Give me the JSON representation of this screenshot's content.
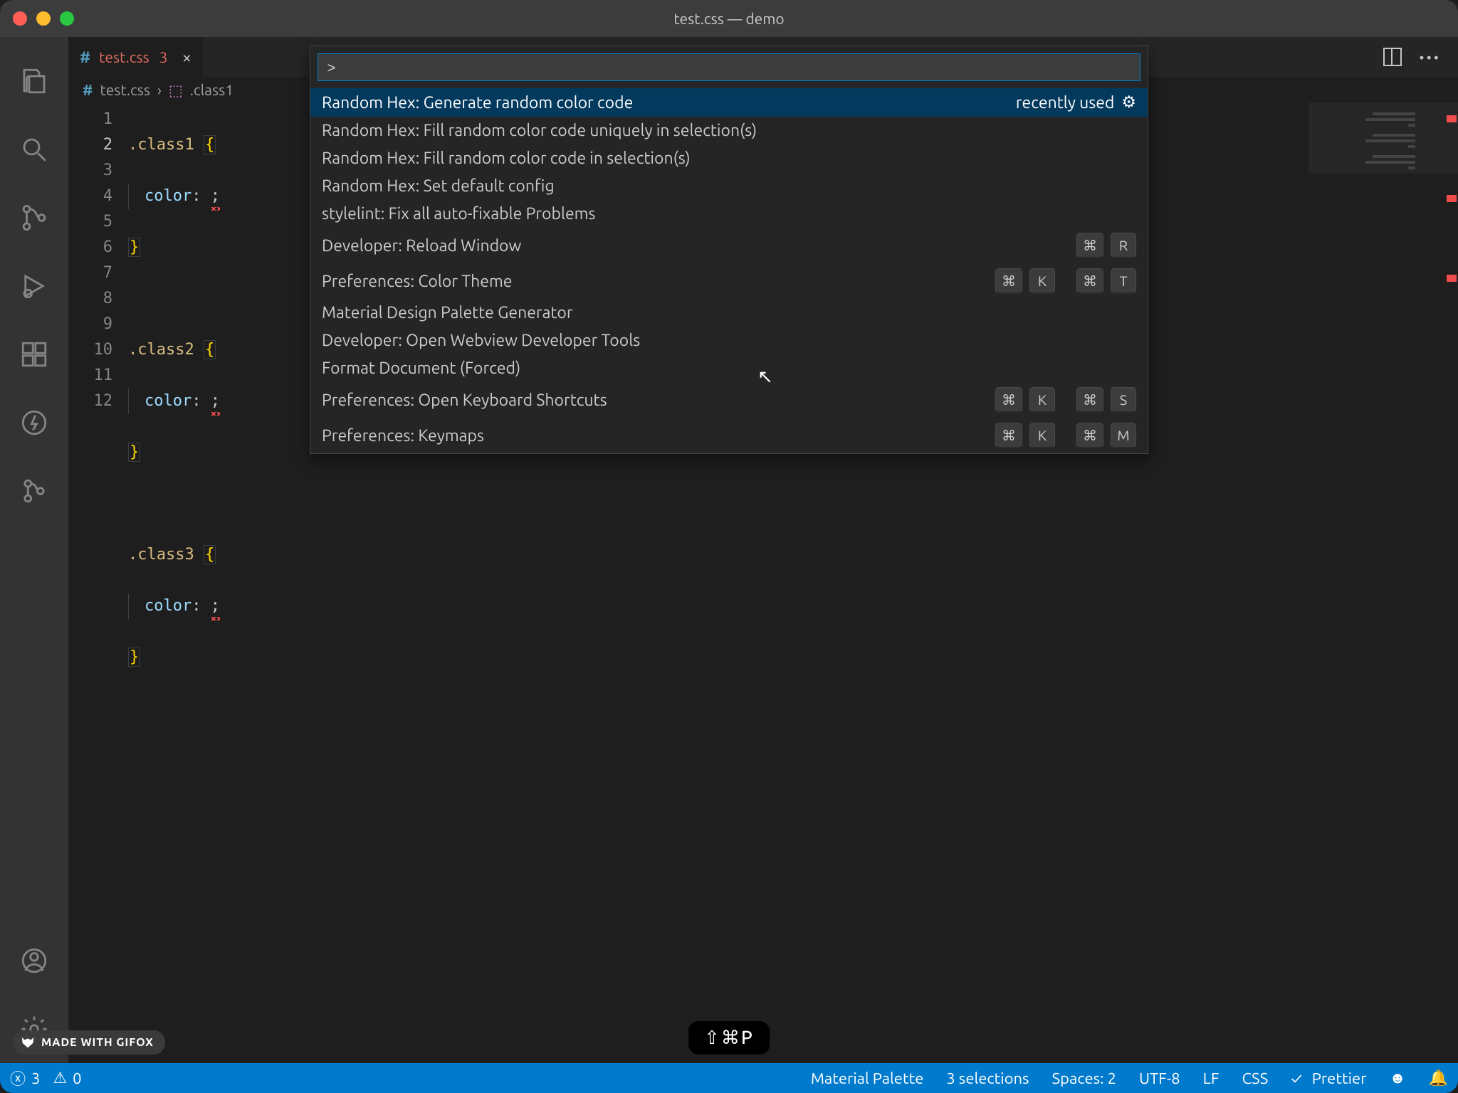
{
  "window": {
    "title": "test.css — demo"
  },
  "tab": {
    "filename": "test.css",
    "dirty_count": "3"
  },
  "breadcrumb": {
    "file": "test.css",
    "symbol": ".class1"
  },
  "editor": {
    "lines": [
      "1",
      "2",
      "3",
      "4",
      "5",
      "6",
      "7",
      "8",
      "9",
      "10",
      "11",
      "12"
    ],
    "code": {
      "l1_sel": ".class1",
      "l1_br": "{",
      "l2_prop": "color",
      "l2_colon": ":",
      "l2_semi": ";",
      "l3_br": "}",
      "l5_sel": ".class2",
      "l5_br": "{",
      "l6_prop": "color",
      "l6_colon": ":",
      "l6_semi": ";",
      "l7_br": "}",
      "l9_sel": ".class3",
      "l9_br": "{",
      "l10_prop": "color",
      "l10_colon": ":",
      "l10_semi": ";",
      "l11_br": "}"
    }
  },
  "palette": {
    "input_value": ">",
    "recently_used_label": "recently used",
    "items": [
      {
        "label": "Random Hex: Generate random color code",
        "recent": true,
        "gear": true
      },
      {
        "label": "Random Hex: Fill random color code uniquely in selection(s)"
      },
      {
        "label": "Random Hex: Fill random color code in selection(s)"
      },
      {
        "label": "Random Hex: Set default config"
      },
      {
        "label": "stylelint: Fix all auto-fixable Problems"
      },
      {
        "label": "Developer: Reload Window",
        "keys": [
          [
            "⌘",
            "R"
          ]
        ]
      },
      {
        "label": "Preferences: Color Theme",
        "keys": [
          [
            "⌘",
            "K"
          ],
          [
            "⌘",
            "T"
          ]
        ]
      },
      {
        "label": "Material Design Palette Generator"
      },
      {
        "label": "Developer: Open Webview Developer Tools"
      },
      {
        "label": "Format Document (Forced)"
      },
      {
        "label": "Preferences: Open Keyboard Shortcuts",
        "keys": [
          [
            "⌘",
            "K"
          ],
          [
            "⌘",
            "S"
          ]
        ]
      },
      {
        "label": "Preferences: Keymaps",
        "keys": [
          [
            "⌘",
            "K"
          ],
          [
            "⌘",
            "M"
          ]
        ]
      }
    ]
  },
  "statusbar": {
    "errors": "3",
    "warnings": "0",
    "material_palette": "Material Palette",
    "selections": "3 selections",
    "spaces": "Spaces: 2",
    "encoding": "UTF-8",
    "eol": "LF",
    "language": "CSS",
    "prettier": "Prettier"
  },
  "hint": {
    "text": "⇧⌘P"
  },
  "badge": {
    "text": "MADE WITH GIFOX"
  }
}
